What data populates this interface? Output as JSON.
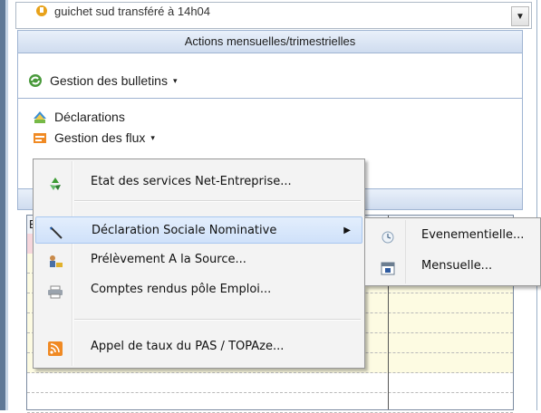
{
  "combo": {
    "text": "guichet sud transféré à 14h04",
    "dropdown_glyph": "▼"
  },
  "panel": {
    "section_monthly": "Actions mensuelles/trimestrielles",
    "gestion_bulletins": "Gestion des bulletins",
    "declarations": "Déclarations",
    "gestion_flux": "Gestion des flux",
    "caret": "▾"
  },
  "grid": {
    "header_first_letter": "E"
  },
  "menu": {
    "items": [
      {
        "label": "Etat des services Net-Entreprise...",
        "icon": "recycle-icon"
      },
      {
        "label": "Déclaration Sociale Nominative",
        "icon": "dsn-pen-icon",
        "has_submenu": true
      },
      {
        "label": "Prélèvement A la Source...",
        "icon": "person-money-icon"
      },
      {
        "label": "Comptes rendus pôle Emploi...",
        "icon": "printer-icon"
      },
      {
        "label": "Appel de taux du PAS / TOPAze...",
        "icon": "rss-icon"
      }
    ],
    "submenu_arrow": "▶"
  },
  "submenu": {
    "items": [
      {
        "label": "Evenementielle...",
        "icon": "clock-icon"
      },
      {
        "label": "Mensuelle...",
        "icon": "calendar-icon"
      }
    ]
  },
  "colors": {
    "menu_bg": "#f3f3f3",
    "highlight": "#cfe1fa",
    "header_bg": "#cfdcef"
  }
}
